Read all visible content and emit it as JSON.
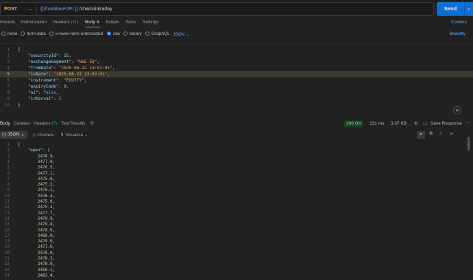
{
  "request": {
    "method": "POST",
    "url_variable": "{{dhanBaseURL}}",
    "url_path": " /charts/intraday",
    "send_label": "Send"
  },
  "request_tabs": {
    "params": "Params",
    "authorization": "Authorization",
    "headers": "Headers",
    "headers_count": "(11)",
    "body": "Body",
    "scripts": "Scripts",
    "tests": "Tests",
    "settings": "Settings",
    "cookies": "Cookies"
  },
  "body_types": {
    "none": "none",
    "form_data": "form-data",
    "urlencoded": "x-www-form-urlencoded",
    "raw": "raw",
    "binary": "binary",
    "graphql": "GraphQL",
    "language": "JSON",
    "beautify": "Beautify"
  },
  "request_body": [
    {
      "ln": "1",
      "html": "{"
    },
    {
      "ln": "2",
      "html": "    <span class=\"k\">\"securityId\"</span>: <span class=\"n\">25</span>,"
    },
    {
      "ln": "3",
      "html": "    <span class=\"k\">\"exchangeSegment\"</span>: <span class=\"s\">\"NSE_EQ\"</span>,"
    },
    {
      "ln": "4",
      "html": "    <span class=\"k\">\"fromDate\"</span>: <span class=\"s\">\"2025-06-22 13:01:01\"</span>,"
    },
    {
      "ln": "5",
      "html": "    <span class=\"k\">\"toDate\"</span>: <span class=\"s\">\"2025-06-22 13:02:01\"</span>,"
    },
    {
      "ln": "6",
      "html": "    <span class=\"k\">\"instrument\"</span>: <span class=\"s\">\"EQUITY\"</span>,"
    },
    {
      "ln": "7",
      "html": "    <span class=\"k\">\"expiryCode\"</span>: <span class=\"n\">0</span>,"
    },
    {
      "ln": "8",
      "html": "    <span class=\"k\">\"oi\"</span>: <span class=\"b\">false</span>,"
    },
    {
      "ln": "9",
      "html": "    <span class=\"k\">\"interval\"</span>: <span class=\"n\">1</span>"
    },
    {
      "ln": "10",
      "html": "}"
    }
  ],
  "active_request_line": 5,
  "response_tabs": {
    "body": "Body",
    "cookies": "Cookies",
    "headers": "Headers",
    "headers_count": "(7)",
    "test_results": "Test Results"
  },
  "response_meta": {
    "status": "200 OK",
    "time": "131 ms",
    "size": "3.37 KB",
    "save_response": "Save Response"
  },
  "response_toolbar": {
    "format": "JSON",
    "preview": "Preview",
    "visualize": "Visualize"
  },
  "response_body": [
    {
      "ln": "1",
      "text": "{"
    },
    {
      "ln": "2",
      "text": "    \"open\": ["
    },
    {
      "ln": "3",
      "text": "        2478.9,"
    },
    {
      "ln": "4",
      "text": "        2477.9,"
    },
    {
      "ln": "5",
      "text": "        2476.5,"
    },
    {
      "ln": "6",
      "text": "        2477.1,"
    },
    {
      "ln": "7",
      "text": "        2475.0,"
    },
    {
      "ln": "8",
      "text": "        2475.2,"
    },
    {
      "ln": "9",
      "text": "        2476.1,"
    },
    {
      "ln": "10",
      "text": "        2476.4,"
    },
    {
      "ln": "11",
      "text": "        2475.0,"
    },
    {
      "ln": "12",
      "text": "        2475.3,"
    },
    {
      "ln": "13",
      "text": "        2477.7,"
    },
    {
      "ln": "14",
      "text": "        2479.9,"
    },
    {
      "ln": "15",
      "text": "        2479.4,"
    },
    {
      "ln": "16",
      "text": "        2478.9,"
    },
    {
      "ln": "17",
      "text": "        2480.0,"
    },
    {
      "ln": "18",
      "text": "        2479.0,"
    },
    {
      "ln": "19",
      "text": "        2477.0,"
    },
    {
      "ln": "20",
      "text": "        2478.0,"
    },
    {
      "ln": "21",
      "text": "        2478.3,"
    },
    {
      "ln": "22",
      "text": "        2478.0,"
    },
    {
      "ln": "23",
      "text": "        2480.1,"
    },
    {
      "ln": "24",
      "text": "        2482.4,"
    }
  ]
}
